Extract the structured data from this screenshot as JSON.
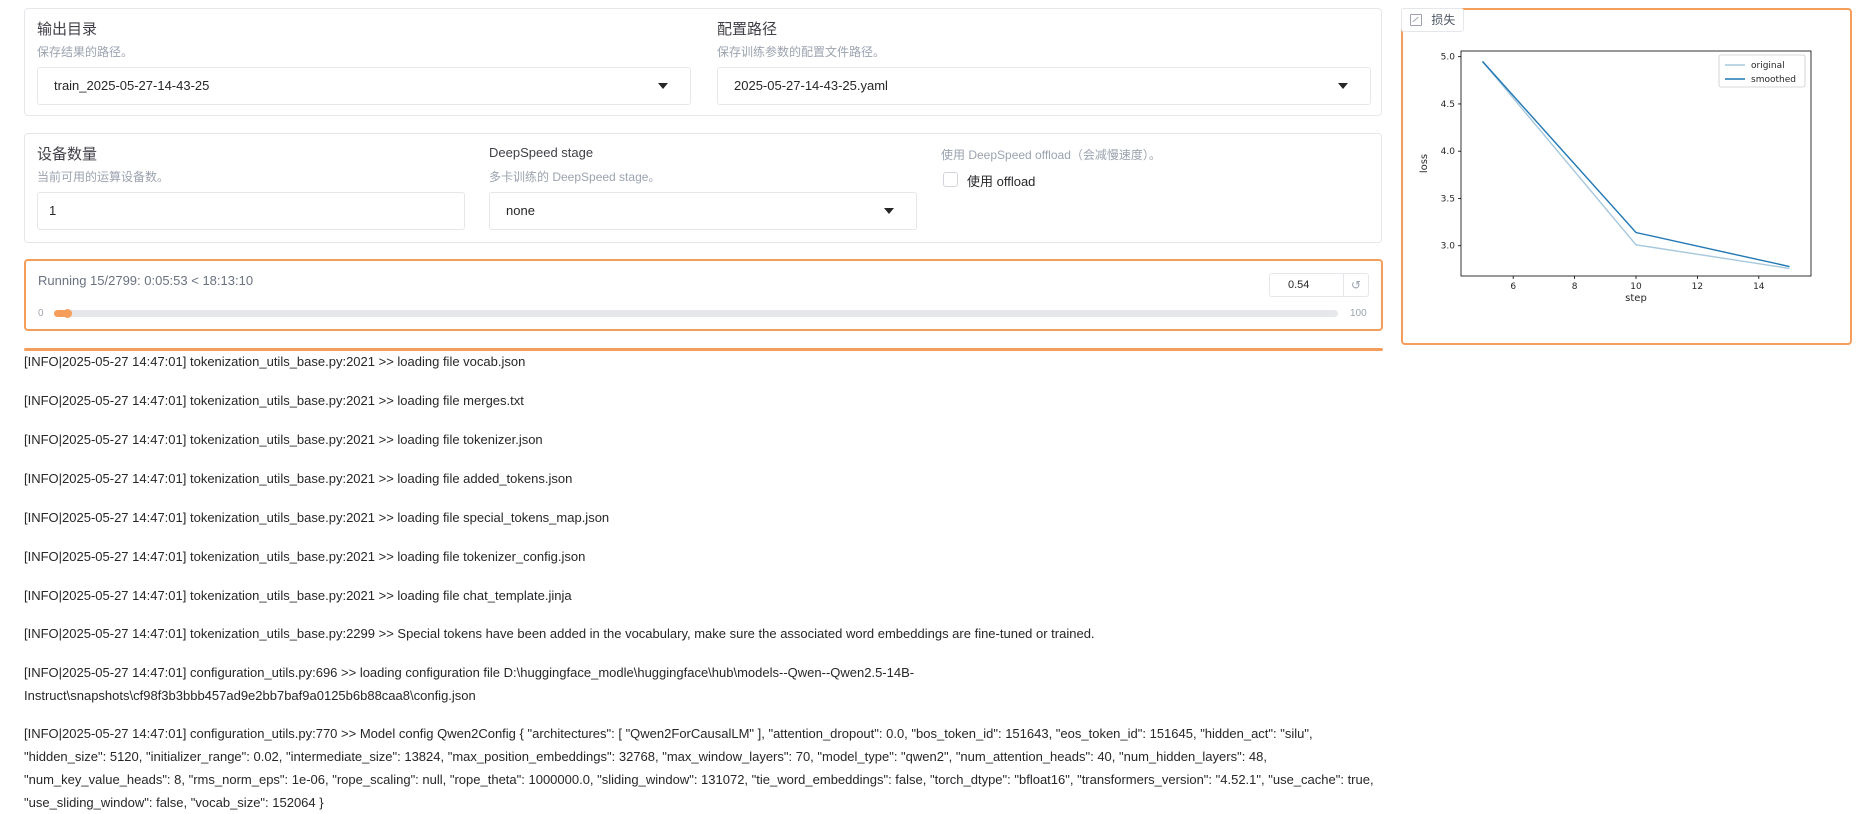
{
  "output_dir": {
    "label": "输出目录",
    "info": "保存结果的路径。",
    "value": "train_2025-05-27-14-43-25"
  },
  "config_path": {
    "label": "配置路径",
    "info": "保存训练参数的配置文件路径。",
    "value": "2025-05-27-14-43-25.yaml"
  },
  "device_count": {
    "label": "设备数量",
    "info": "当前可用的运算设备数。",
    "value": "1"
  },
  "deepspeed_stage": {
    "label": "DeepSpeed stage",
    "info": "多卡训练的 DeepSpeed stage。",
    "value": "none"
  },
  "deepspeed_offload": {
    "info": "使用 DeepSpeed offload（会减慢速度）。",
    "label": "使用 offload",
    "checked": false
  },
  "progress": {
    "status": "Running 15/2799: 0:05:53 < 18:13:10",
    "value_text": "0.54",
    "value": 0.54,
    "min_label": "0",
    "max_label": "100",
    "reset_icon": "reset-icon",
    "bar_color": "#f59e5c"
  },
  "chart_panel": {
    "tab_label": "损失",
    "tab_icon": "chart-icon"
  },
  "chart_data": {
    "type": "line",
    "xlabel": "step",
    "ylabel": "loss",
    "xlim": [
      4.3,
      15.7
    ],
    "ylim": [
      2.68,
      5.06
    ],
    "xticks": [
      "6",
      "8",
      "10",
      "12",
      "14"
    ],
    "yticks": [
      "3.0",
      "3.5",
      "4.0",
      "4.5",
      "5.0"
    ],
    "legend_position": "top-right",
    "series": [
      {
        "name": "original",
        "x": [
          5,
          10,
          15
        ],
        "y": [
          4.95,
          3.01,
          2.76
        ],
        "color": "#a6c8dd"
      },
      {
        "name": "smoothed",
        "x": [
          5,
          10,
          15
        ],
        "y": [
          4.95,
          3.14,
          2.78
        ],
        "color": "#1f77b4"
      }
    ]
  },
  "logs": [
    "[INFO|2025-05-27 14:47:01] tokenization_utils_base.py:2021 >> loading file vocab.json",
    "[INFO|2025-05-27 14:47:01] tokenization_utils_base.py:2021 >> loading file merges.txt",
    "[INFO|2025-05-27 14:47:01] tokenization_utils_base.py:2021 >> loading file tokenizer.json",
    "[INFO|2025-05-27 14:47:01] tokenization_utils_base.py:2021 >> loading file added_tokens.json",
    "[INFO|2025-05-27 14:47:01] tokenization_utils_base.py:2021 >> loading file special_tokens_map.json",
    "[INFO|2025-05-27 14:47:01] tokenization_utils_base.py:2021 >> loading file tokenizer_config.json",
    "[INFO|2025-05-27 14:47:01] tokenization_utils_base.py:2021 >> loading file chat_template.jinja",
    "[INFO|2025-05-27 14:47:01] tokenization_utils_base.py:2299 >> Special tokens have been added in the vocabulary, make sure the associated word embeddings are fine-tuned or trained.",
    "[INFO|2025-05-27 14:47:01] configuration_utils.py:696 >> loading configuration file D:\\huggingface_modle\\huggingface\\hub\\models--Qwen--Qwen2.5-14B-Instruct\\snapshots\\cf98f3b3bbb457ad9e2bb7baf9a0125b6b88caa8\\config.json",
    "[INFO|2025-05-27 14:47:01] configuration_utils.py:770 >> Model config Qwen2Config { \"architectures\": [ \"Qwen2ForCausalLM\" ], \"attention_dropout\": 0.0, \"bos_token_id\": 151643, \"eos_token_id\": 151645, \"hidden_act\": \"silu\", \"hidden_size\": 5120, \"initializer_range\": 0.02, \"intermediate_size\": 13824, \"max_position_embeddings\": 32768, \"max_window_layers\": 70, \"model_type\": \"qwen2\", \"num_attention_heads\": 40, \"num_hidden_layers\": 48, \"num_key_value_heads\": 8, \"rms_norm_eps\": 1e-06, \"rope_scaling\": null, \"rope_theta\": 1000000.0, \"sliding_window\": 131072, \"tie_word_embeddings\": false, \"torch_dtype\": \"bfloat16\", \"transformers_version\": \"4.52.1\", \"use_cache\": true, \"use_sliding_window\": false, \"vocab_size\": 152064 }"
  ]
}
